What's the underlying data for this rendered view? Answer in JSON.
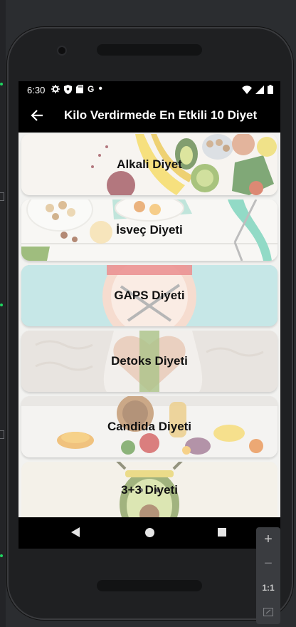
{
  "status_bar": {
    "time": "6:30",
    "left_icons": [
      "gear-icon",
      "shield-icon",
      "sd-card-icon",
      "google-icon",
      "dot-icon"
    ],
    "right_icons": [
      "wifi-icon",
      "signal-icon",
      "battery-icon"
    ]
  },
  "app_bar": {
    "title": "Kilo Verdirmede En Etkili 10 Diyet"
  },
  "diets": [
    {
      "label": "Alkali Diyet"
    },
    {
      "label": "İsveç Diyeti"
    },
    {
      "label": "GAPS Diyeti"
    },
    {
      "label": "Detoks Diyeti"
    },
    {
      "label": "Candida Diyeti"
    },
    {
      "label": "3+3 Diyeti"
    }
  ],
  "zoom_controls": {
    "plus": "+",
    "minus": "−",
    "ratio": "1:1"
  }
}
